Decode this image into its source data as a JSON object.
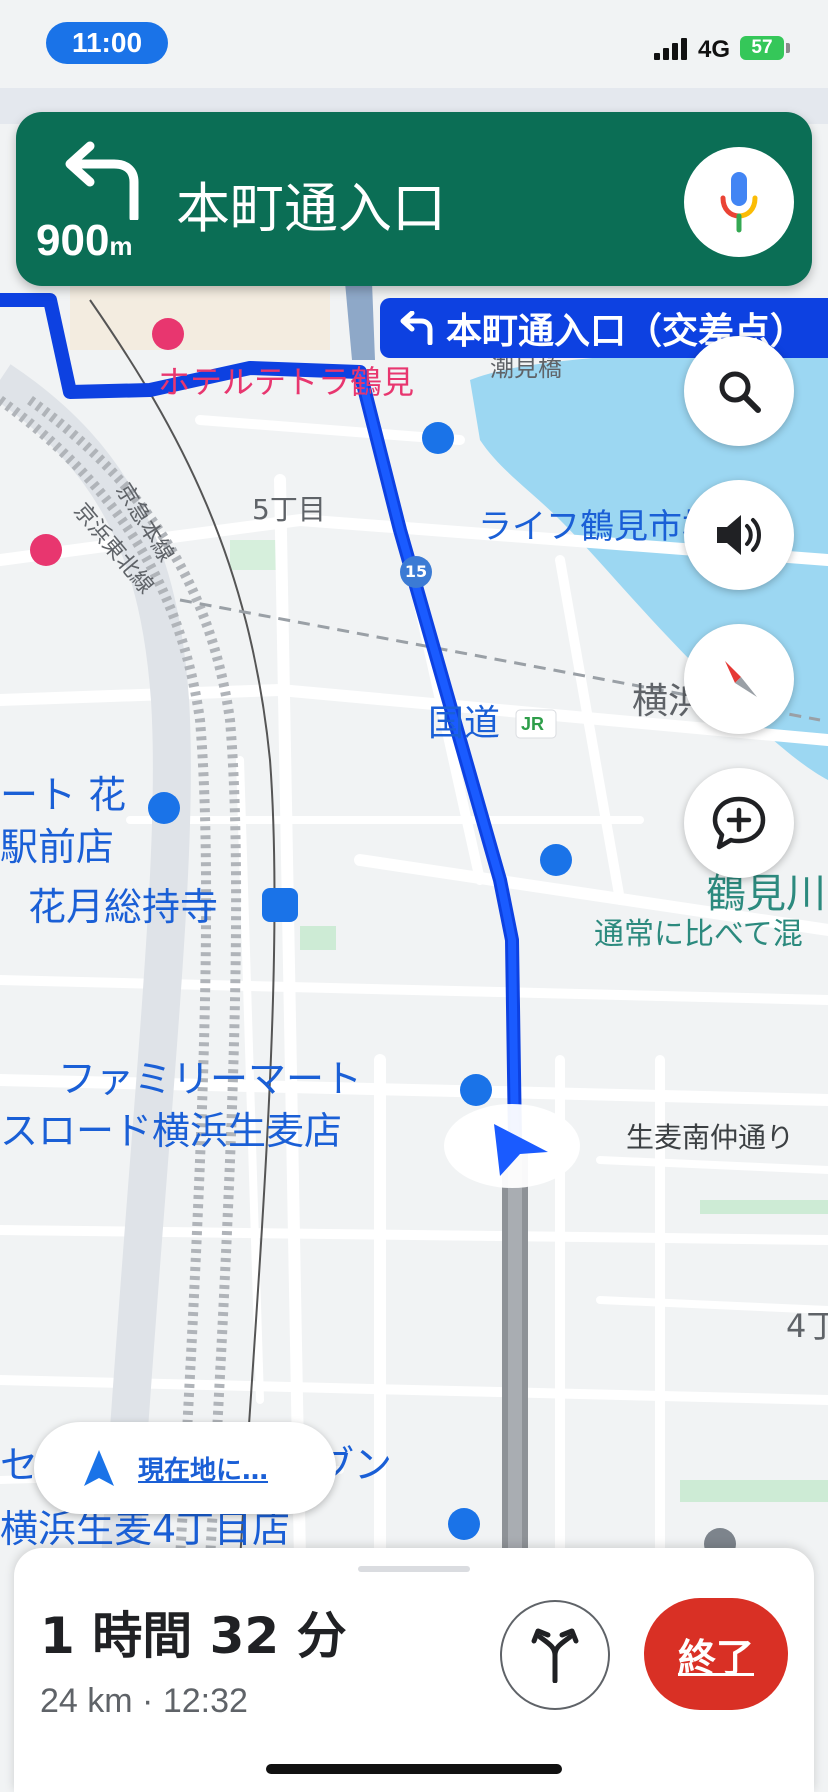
{
  "status_bar": {
    "time": "11:00",
    "network": "4G",
    "battery": "57"
  },
  "banner": {
    "distance_value": "900",
    "distance_unit": "m",
    "street": "本町通入口",
    "turn_icon": "turn-left-icon",
    "color": "#0b6e55"
  },
  "route_label": "本町通入口（交差点）",
  "map_labels": {
    "hotel": "ホテルテトラ鶴見",
    "bridge": "潮見橋",
    "chome5": "5丁目",
    "life": "ライフ鶴見市場",
    "route15": "15",
    "keikyu": "京急本線",
    "keihin": "京浜東北線",
    "kokudo": "国道",
    "jr": "JR",
    "yokohama": "横浜",
    "store1_line1": "ート 花",
    "store1_line2": "駅前店",
    "kagetsu": "花月総持寺",
    "tsurumi_river": "鶴見川",
    "traffic_note": "通常に比べて混",
    "family_line1": "ファミリーマート",
    "family_line2": "スロード横浜生麦店",
    "namamugi": "生麦南仲通り",
    "seven_line1": "セ",
    "seven_line2": "ブン",
    "seven_line3": "横浜生麦4丁目店",
    "four": "4丁"
  },
  "recenter_label": "現在地に…",
  "eta": {
    "duration": "1 時間 32 分",
    "distance": "24 km",
    "arrival": "12:32"
  },
  "end_label": "終了",
  "colors": {
    "route_blue": "#0d41e1",
    "end_red": "#d93025",
    "water": "#9cd7f2",
    "accent": "#1a73e8"
  }
}
